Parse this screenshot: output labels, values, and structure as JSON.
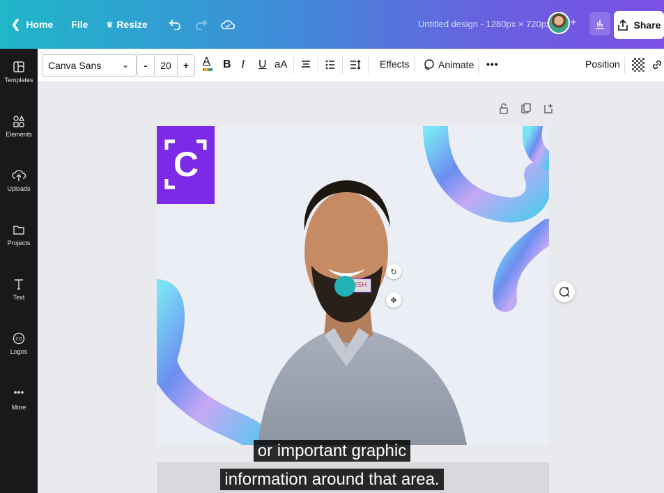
{
  "topbar": {
    "home_label": "Home",
    "file_label": "File",
    "resize_label": "Resize",
    "title": "Untitled design - 1280px × 720px",
    "share_label": "Share"
  },
  "sidebar": {
    "items": [
      {
        "label": "Templates",
        "icon": "templates-icon"
      },
      {
        "label": "Elements",
        "icon": "elements-icon"
      },
      {
        "label": "Uploads",
        "icon": "uploads-icon"
      },
      {
        "label": "Projects",
        "icon": "projects-icon"
      },
      {
        "label": "Text",
        "icon": "text-icon"
      },
      {
        "label": "Logos",
        "icon": "logos-icon"
      },
      {
        "label": "More",
        "icon": "more-icon"
      }
    ]
  },
  "toolbar": {
    "font": "Canva Sans",
    "font_size": "20",
    "minus": "-",
    "plus": "+",
    "bold": "B",
    "italic": "I",
    "underline": "U",
    "case": "aA",
    "effects_label": "Effects",
    "animate_label": "Animate",
    "more": "•••",
    "position_label": "Position",
    "text_color": "#e53935"
  },
  "canvas": {
    "logo_letter": "C",
    "text_fragment": "ISH",
    "accent": "#7d2ae8",
    "teal": "#20b2b5"
  },
  "caption": {
    "line1": "or important graphic",
    "line2": "information around that area."
  }
}
